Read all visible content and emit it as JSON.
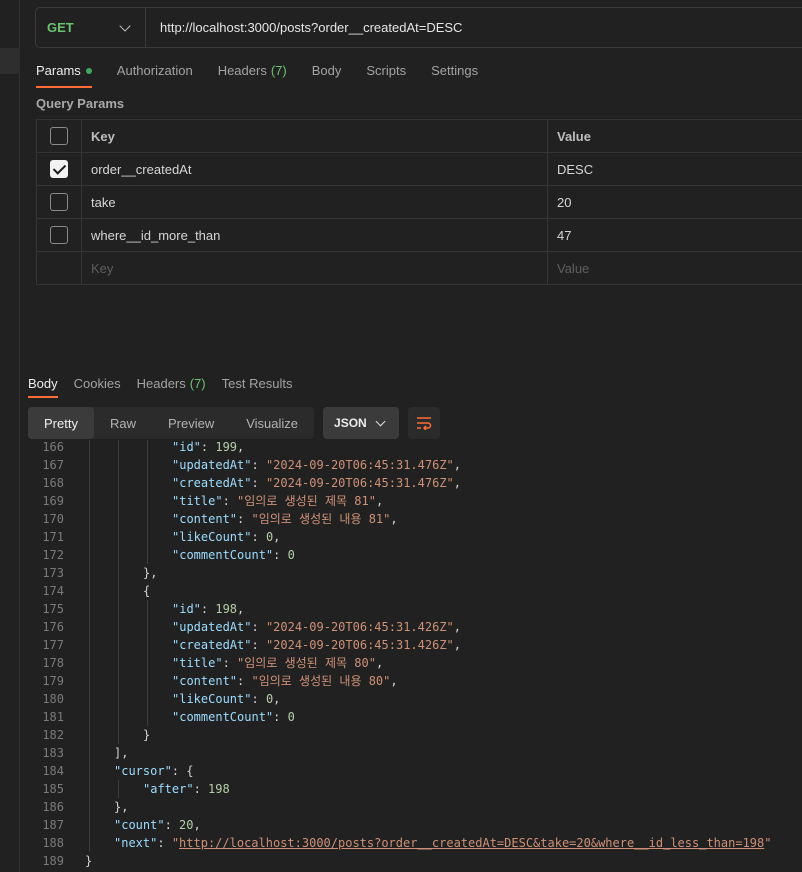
{
  "request": {
    "method": "GET",
    "url": "http://localhost:3000/posts?order__createdAt=DESC"
  },
  "request_tabs": [
    {
      "label": "Params",
      "active": true,
      "dot": true
    },
    {
      "label": "Authorization"
    },
    {
      "label": "Headers",
      "count": "(7)"
    },
    {
      "label": "Body"
    },
    {
      "label": "Scripts"
    },
    {
      "label": "Settings"
    }
  ],
  "query_params": {
    "title": "Query Params",
    "header": {
      "key": "Key",
      "value": "Value"
    },
    "rows": [
      {
        "checked": true,
        "key": "order__createdAt",
        "value": "DESC"
      },
      {
        "checked": false,
        "key": "take",
        "value": "20"
      },
      {
        "checked": false,
        "key": "where__id_more_than",
        "value": "47"
      }
    ],
    "placeholder": {
      "key": "Key",
      "value": "Value"
    }
  },
  "response_tabs": [
    {
      "label": "Body",
      "active": true
    },
    {
      "label": "Cookies"
    },
    {
      "label": "Headers",
      "count": "(7)"
    },
    {
      "label": "Test Results"
    }
  ],
  "view_modes": [
    "Pretty",
    "Raw",
    "Preview",
    "Visualize"
  ],
  "active_view": "Pretty",
  "format": "JSON",
  "icons": {
    "wrap": "wrap-lines-icon",
    "dropdown": "chevron-down-icon"
  },
  "colors": {
    "accent": "#ff6c37",
    "method_get": "#6bc36f",
    "json_key": "#9cdcfe",
    "json_string": "#ce9178",
    "json_number": "#b5cea8"
  },
  "code_lines": [
    {
      "n": "166",
      "indent": 4,
      "tokens": [
        [
          "k",
          "\"id\""
        ],
        [
          "p",
          ": "
        ],
        [
          "n",
          "199"
        ],
        [
          "p",
          ","
        ]
      ]
    },
    {
      "n": "167",
      "indent": 4,
      "tokens": [
        [
          "k",
          "\"updatedAt\""
        ],
        [
          "p",
          ": "
        ],
        [
          "s",
          "\"2024-09-20T06:45:31.476Z\""
        ],
        [
          "p",
          ","
        ]
      ]
    },
    {
      "n": "168",
      "indent": 4,
      "tokens": [
        [
          "k",
          "\"createdAt\""
        ],
        [
          "p",
          ": "
        ],
        [
          "s",
          "\"2024-09-20T06:45:31.476Z\""
        ],
        [
          "p",
          ","
        ]
      ]
    },
    {
      "n": "169",
      "indent": 4,
      "tokens": [
        [
          "k",
          "\"title\""
        ],
        [
          "p",
          ": "
        ],
        [
          "s",
          "\"임의로 생성된 제목 81\""
        ],
        [
          "p",
          ","
        ]
      ]
    },
    {
      "n": "170",
      "indent": 4,
      "tokens": [
        [
          "k",
          "\"content\""
        ],
        [
          "p",
          ": "
        ],
        [
          "s",
          "\"임의로 생성된 내용 81\""
        ],
        [
          "p",
          ","
        ]
      ]
    },
    {
      "n": "171",
      "indent": 4,
      "tokens": [
        [
          "k",
          "\"likeCount\""
        ],
        [
          "p",
          ": "
        ],
        [
          "n",
          "0"
        ],
        [
          "p",
          ","
        ]
      ]
    },
    {
      "n": "172",
      "indent": 4,
      "tokens": [
        [
          "k",
          "\"commentCount\""
        ],
        [
          "p",
          ": "
        ],
        [
          "n",
          "0"
        ]
      ]
    },
    {
      "n": "173",
      "indent": 3,
      "tokens": [
        [
          "p",
          "},"
        ]
      ]
    },
    {
      "n": "174",
      "indent": 3,
      "tokens": [
        [
          "p",
          "{"
        ]
      ]
    },
    {
      "n": "175",
      "indent": 4,
      "tokens": [
        [
          "k",
          "\"id\""
        ],
        [
          "p",
          ": "
        ],
        [
          "n",
          "198"
        ],
        [
          "p",
          ","
        ]
      ]
    },
    {
      "n": "176",
      "indent": 4,
      "tokens": [
        [
          "k",
          "\"updatedAt\""
        ],
        [
          "p",
          ": "
        ],
        [
          "s",
          "\"2024-09-20T06:45:31.426Z\""
        ],
        [
          "p",
          ","
        ]
      ]
    },
    {
      "n": "177",
      "indent": 4,
      "tokens": [
        [
          "k",
          "\"createdAt\""
        ],
        [
          "p",
          ": "
        ],
        [
          "s",
          "\"2024-09-20T06:45:31.426Z\""
        ],
        [
          "p",
          ","
        ]
      ]
    },
    {
      "n": "178",
      "indent": 4,
      "tokens": [
        [
          "k",
          "\"title\""
        ],
        [
          "p",
          ": "
        ],
        [
          "s",
          "\"임의로 생성된 제목 80\""
        ],
        [
          "p",
          ","
        ]
      ]
    },
    {
      "n": "179",
      "indent": 4,
      "tokens": [
        [
          "k",
          "\"content\""
        ],
        [
          "p",
          ": "
        ],
        [
          "s",
          "\"임의로 생성된 내용 80\""
        ],
        [
          "p",
          ","
        ]
      ]
    },
    {
      "n": "180",
      "indent": 4,
      "tokens": [
        [
          "k",
          "\"likeCount\""
        ],
        [
          "p",
          ": "
        ],
        [
          "n",
          "0"
        ],
        [
          "p",
          ","
        ]
      ]
    },
    {
      "n": "181",
      "indent": 4,
      "tokens": [
        [
          "k",
          "\"commentCount\""
        ],
        [
          "p",
          ": "
        ],
        [
          "n",
          "0"
        ]
      ]
    },
    {
      "n": "182",
      "indent": 3,
      "tokens": [
        [
          "p",
          "}"
        ]
      ]
    },
    {
      "n": "183",
      "indent": 2,
      "tokens": [
        [
          "p",
          "],"
        ]
      ]
    },
    {
      "n": "184",
      "indent": 2,
      "tokens": [
        [
          "k",
          "\"cursor\""
        ],
        [
          "p",
          ": {"
        ]
      ]
    },
    {
      "n": "185",
      "indent": 3,
      "tokens": [
        [
          "k",
          "\"after\""
        ],
        [
          "p",
          ": "
        ],
        [
          "n",
          "198"
        ]
      ]
    },
    {
      "n": "186",
      "indent": 2,
      "tokens": [
        [
          "p",
          "},"
        ]
      ]
    },
    {
      "n": "187",
      "indent": 2,
      "tokens": [
        [
          "k",
          "\"count\""
        ],
        [
          "p",
          ": "
        ],
        [
          "n",
          "20"
        ],
        [
          "p",
          ","
        ]
      ]
    },
    {
      "n": "188",
      "indent": 2,
      "tokens": [
        [
          "k",
          "\"next\""
        ],
        [
          "p",
          ": "
        ],
        [
          "s",
          "\""
        ],
        [
          "u",
          "http://localhost:3000/posts?order__createdAt=DESC&take=20&where__id_less_than=198"
        ],
        [
          "s",
          "\""
        ]
      ]
    },
    {
      "n": "189",
      "indent": 1,
      "tokens": [
        [
          "p",
          "}"
        ]
      ]
    }
  ]
}
